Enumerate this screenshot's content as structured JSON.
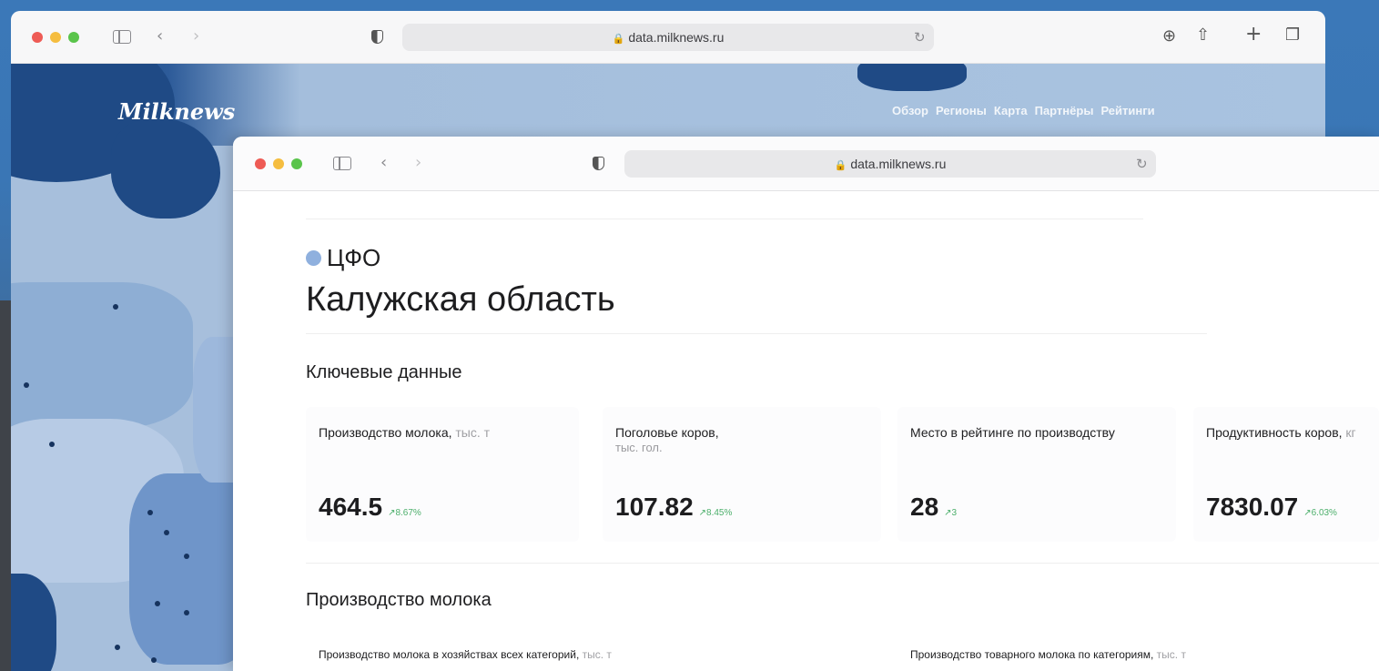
{
  "browser": {
    "url": "data.milknews.ru"
  },
  "back_site": {
    "logo": "Milknews",
    "nav": [
      "Обзор",
      "Регионы",
      "Карта",
      "Партнёры",
      "Рейтинги"
    ]
  },
  "page": {
    "district": "ЦФО",
    "region": "Калужская область",
    "key_section_title": "Ключевые данные",
    "key_metrics": [
      {
        "label": "Производство молока,",
        "unit": "тыс. т",
        "sublabel": "",
        "value": "464.5",
        "delta": "↗8.67%"
      },
      {
        "label": "Поголовье коров,",
        "unit": "",
        "sublabel": "тыс. гол.",
        "value": "107.82",
        "delta": "↗8.45%"
      },
      {
        "label": "Место в рейтинге по производству",
        "unit": "",
        "sublabel": "",
        "value": "28",
        "delta": "↗3"
      },
      {
        "label": "Продуктивность коров,",
        "unit": "кг",
        "sublabel": "",
        "value": "7830.07",
        "delta": "↗6.03%"
      }
    ],
    "production_section_title": "Производство молока",
    "production_charts": [
      {
        "label": "Производство молока в хозяйствах всех категорий,",
        "unit": "тыс. т"
      },
      {
        "label": "Производство товарного молока по категориям,",
        "unit": "тыс. т"
      }
    ]
  },
  "colors": {
    "district_dot": "#8fb0de",
    "delta_green": "#4caf6b",
    "map_dark": "#1f4a85"
  }
}
